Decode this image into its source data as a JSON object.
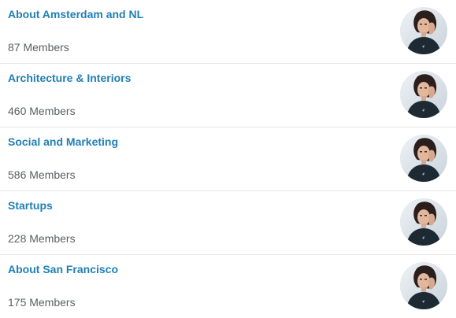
{
  "groups": [
    {
      "title": "About Amsterdam and NL",
      "members": "87 Members",
      "avatar_icon": "member-avatar-photo"
    },
    {
      "title": "Architecture & Interiors",
      "members": "460 Members",
      "avatar_icon": "member-avatar-photo"
    },
    {
      "title": "Social and Marketing",
      "members": "586 Members",
      "avatar_icon": "member-avatar-photo"
    },
    {
      "title": "Startups",
      "members": "228 Members",
      "avatar_icon": "member-avatar-photo"
    },
    {
      "title": "About San Francisco",
      "members": "175 Members",
      "avatar_icon": "member-avatar-photo"
    }
  ],
  "colors": {
    "link": "#1f7fb5",
    "meta": "#5b5f63",
    "divider": "#e4e6e8"
  }
}
